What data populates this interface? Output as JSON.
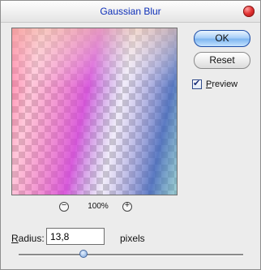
{
  "window": {
    "title": "Gaussian Blur"
  },
  "buttons": {
    "ok_label": "OK",
    "reset_label": "Reset"
  },
  "preview_option": {
    "label_first": "P",
    "label_rest": "review",
    "checked": true
  },
  "zoom": {
    "level": "100%",
    "minus_symbol": "−",
    "plus_symbol": "+"
  },
  "radius": {
    "label_first": "R",
    "label_rest": "adius:",
    "value": "13,8",
    "unit": "pixels",
    "slider_fraction": 0.29
  },
  "colors": {
    "title": "#0d2fb8",
    "ok_accent": "#7fb7f0",
    "preview_pink": "#ff4d7a",
    "preview_magenta": "#d23fd6",
    "preview_blue": "#3f63b8",
    "preview_teal": "#5fb7b5"
  },
  "icons": {
    "close": "close-icon",
    "zoom_out": "zoom-out-icon",
    "zoom_in": "zoom-in-icon",
    "checkbox": "checkmark-icon"
  }
}
